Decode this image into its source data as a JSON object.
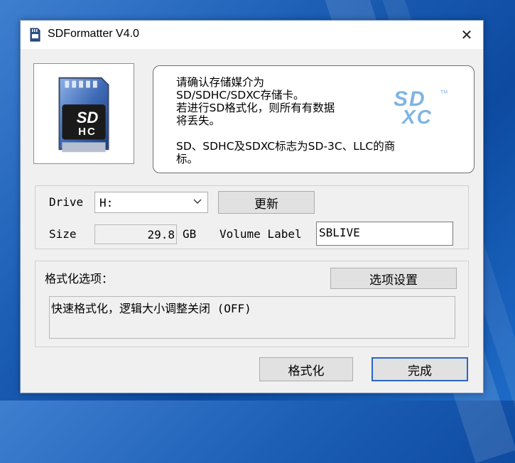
{
  "window": {
    "title": "SDFormatter V4.0",
    "close_glyph": "✕"
  },
  "info": {
    "message": "请确认存储媒介为\nSD/SDHC/SDXC存储卡。\n若进行SD格式化，则所有有数据\n将丢失。",
    "trademark": "SD、SDHC及SDXC标志为SD-3C、LLC的商\n标。"
  },
  "logos": {
    "card_letters": "SD",
    "card_letters2": "HC",
    "sdxc_letters1": "SD",
    "sdxc_letters2": "XC",
    "sdxc_tm": "TM",
    "sdxc_color": "#7fb4e3"
  },
  "drive": {
    "drive_label": "Drive",
    "drive_value": "H:",
    "refresh_label": "更新",
    "size_label": "Size",
    "size_value": "29.8",
    "size_unit": "GB",
    "volume_label": "Volume Label",
    "volume_value": "SBLIVE"
  },
  "options": {
    "header": "格式化选项：",
    "settings_label": "选项设置",
    "summary": "快速格式化，逻辑大小调整关闭 (OFF)"
  },
  "footer": {
    "format_label": "格式化",
    "done_label": "完成"
  }
}
